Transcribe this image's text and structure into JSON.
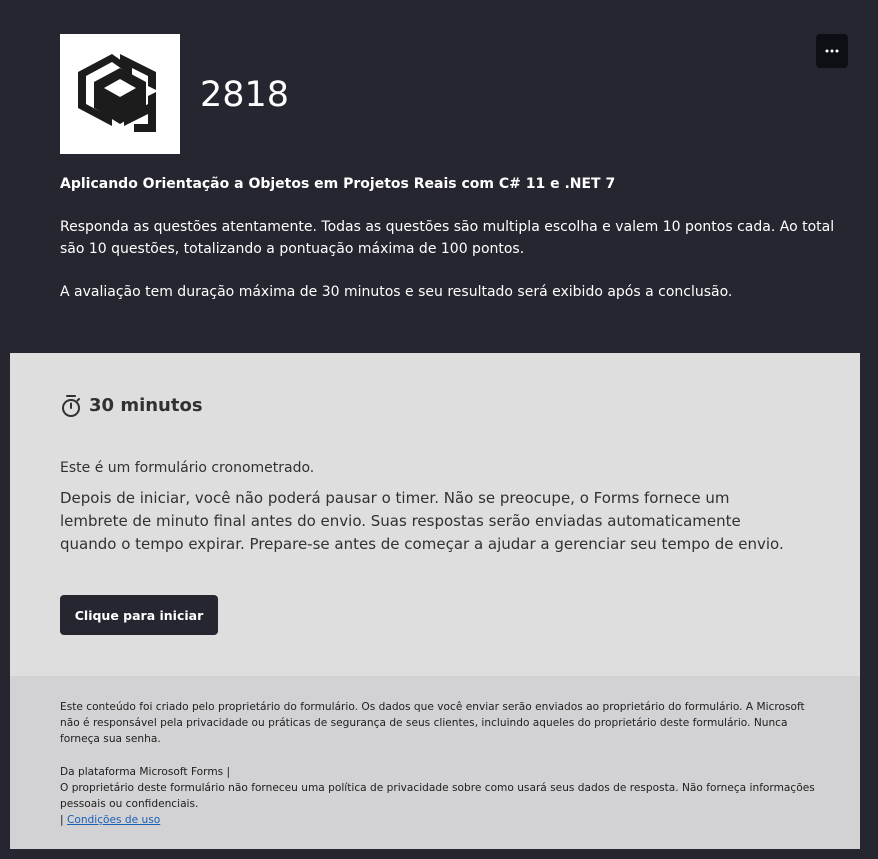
{
  "header": {
    "form_id": "2818",
    "course_title": "Aplicando Orientação a Objetos em Projetos Reais com C# 11 e .NET 7",
    "description_1": "Responda as questões atentamente. Todas as questões são multipla escolha e valem 10 pontos cada. Ao total são 10 questões, totalizando a pontuação máxima de 100 pontos.",
    "description_2": "A avaliação tem duração máxima de 30 minutos e seu resultado será exibido após a conclusão.",
    "more_icon": "more-horizontal-icon"
  },
  "timer": {
    "icon": "stopwatch-icon",
    "label": "30 minutos",
    "title": "Este é um formulário cronometrado.",
    "description": "Depois de iniciar, você não poderá pausar o timer. Não se preocupe, o Forms fornece um lembrete de minuto final antes do envio. Suas respostas serão enviadas automaticamente quando o tempo expirar. Prepare-se antes de começar a ajudar a gerenciar seu tempo de envio.",
    "start_button": "Clique para iniciar"
  },
  "footer": {
    "disclaimer": "Este conteúdo foi criado pelo proprietário do formulário. Os dados que você enviar serão enviados ao proprietário do formulário. A Microsoft não é responsável pela privacidade ou práticas de segurança de seus clientes, incluindo aqueles do proprietário deste formulário. Nunca forneça sua senha.",
    "platform": "Da plataforma Microsoft Forms |",
    "privacy_note": "O proprietário deste formulário não forneceu uma política de privacidade sobre como usará seus dados de resposta. Não forneça informações pessoais ou confidenciais.",
    "separator": "| ",
    "terms_link": "Condições de uso"
  },
  "colors": {
    "background": "#25262f",
    "card": "#dedede",
    "footer": "#d2d2d5",
    "button": "#25262f",
    "link": "#1a5fb4"
  }
}
